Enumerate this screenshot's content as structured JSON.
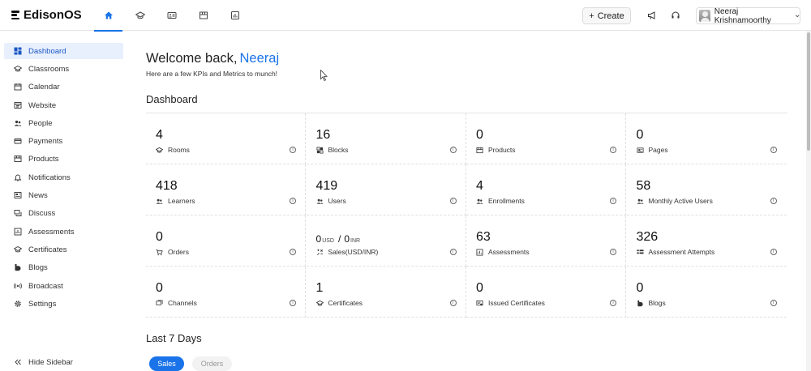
{
  "app": {
    "name": "EdisonOS"
  },
  "header": {
    "tabs": [
      {
        "icon": "home-icon",
        "active": true
      },
      {
        "icon": "graduation-cap-icon"
      },
      {
        "icon": "id-card-icon"
      },
      {
        "icon": "storefront-icon"
      },
      {
        "icon": "chart-box-icon"
      }
    ],
    "create_label": "Create",
    "user_name": "Neeraj Krishnamoorthy"
  },
  "sidebar": {
    "items": [
      {
        "label": "Dashboard",
        "icon": "dashboard-icon"
      },
      {
        "label": "Classrooms",
        "icon": "graduation-cap-icon"
      },
      {
        "label": "Calendar",
        "icon": "calendar-icon"
      },
      {
        "label": "Website",
        "icon": "website-icon"
      },
      {
        "label": "People",
        "icon": "people-icon"
      },
      {
        "label": "Payments",
        "icon": "payments-icon"
      },
      {
        "label": "Products",
        "icon": "products-icon"
      },
      {
        "label": "Notifications",
        "icon": "bell-icon"
      },
      {
        "label": "News",
        "icon": "news-icon"
      },
      {
        "label": "Discuss",
        "icon": "discuss-icon"
      },
      {
        "label": "Assessments",
        "icon": "assessments-icon"
      },
      {
        "label": "Certificates",
        "icon": "certificate-icon"
      },
      {
        "label": "Blogs",
        "icon": "blogs-icon"
      },
      {
        "label": "Broadcast",
        "icon": "broadcast-icon"
      },
      {
        "label": "Settings",
        "icon": "gear-icon"
      }
    ],
    "hide_label": "Hide Sidebar"
  },
  "main": {
    "welcome": "Welcome back,",
    "user_first": "Neeraj",
    "subtitle": "Here are a few KPIs and Metrics to munch!",
    "dashboard_title": "Dashboard",
    "kpis": [
      {
        "value": "4",
        "label": "Rooms",
        "icon": "graduation-cap-icon"
      },
      {
        "value": "16",
        "label": "Blocks",
        "icon": "blocks-icon"
      },
      {
        "value": "0",
        "label": "Products",
        "icon": "storefront-icon"
      },
      {
        "value": "0",
        "label": "Pages",
        "icon": "pages-icon"
      },
      {
        "value": "418",
        "label": "Learners",
        "icon": "people-icon"
      },
      {
        "value": "419",
        "label": "Users",
        "icon": "people-icon"
      },
      {
        "value": "4",
        "label": "Enrollments",
        "icon": "people-icon"
      },
      {
        "value": "58",
        "label": "Monthly Active Users",
        "icon": "people-icon"
      },
      {
        "value": "0",
        "label": "Orders",
        "icon": "cart-icon"
      },
      {
        "value": "",
        "label": "Sales(USD/INR)",
        "icon": "sales-icon",
        "usd": "0",
        "usd_unit": "USD",
        "separator": "/",
        "inr": "0",
        "inr_unit": "INR"
      },
      {
        "value": "63",
        "label": "Assessments",
        "icon": "assessments-icon"
      },
      {
        "value": "326",
        "label": "Assessment Attempts",
        "icon": "attempts-icon"
      },
      {
        "value": "0",
        "label": "Channels",
        "icon": "channels-icon"
      },
      {
        "value": "1",
        "label": "Certificates",
        "icon": "graduation-cap-icon"
      },
      {
        "value": "0",
        "label": "Issued Certificates",
        "icon": "certificate-icon"
      },
      {
        "value": "0",
        "label": "Blogs",
        "icon": "blogs-icon"
      }
    ],
    "info_glyph": "i",
    "last7_title": "Last 7 Days",
    "pills": {
      "sales": "Sales",
      "orders": "Orders"
    }
  },
  "colors": {
    "accent": "#1a73e8",
    "active_bg": "#e8f0fe"
  }
}
